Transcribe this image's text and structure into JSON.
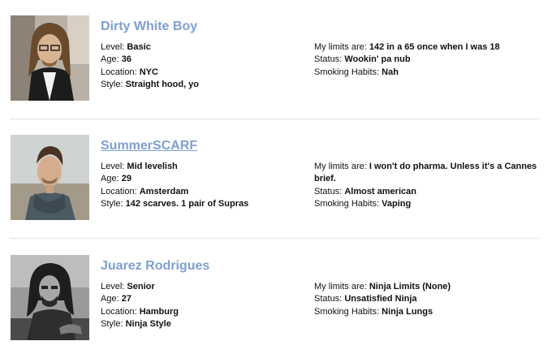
{
  "profiles": [
    {
      "name": "Dirty White Boy",
      "left": [
        {
          "label": "Level:",
          "value": "Basic"
        },
        {
          "label": "Age:",
          "value": "36"
        },
        {
          "label": "Location:",
          "value": "NYC"
        },
        {
          "label": "Style:",
          "value": "Straight hood, yo"
        }
      ],
      "right": [
        {
          "label": "My limits are:",
          "value": "142 in a 65 once when I was 18"
        },
        {
          "label": "Status:",
          "value": "Wookin' pa nub"
        },
        {
          "label": "Smoking Habits:",
          "value": "Nah"
        }
      ]
    },
    {
      "name": "SummerSCARF",
      "left": [
        {
          "label": "Level:",
          "value": "Mid levelish"
        },
        {
          "label": "Age:",
          "value": "29"
        },
        {
          "label": "Location:",
          "value": "Amsterdam"
        },
        {
          "label": "Style:",
          "value": "142 scarves. 1 pair of Supras"
        }
      ],
      "right": [
        {
          "label": "My limits are:",
          "value": "I won't do pharma. Unless it's a Cannes brief."
        },
        {
          "label": "Status:",
          "value": "Almost american"
        },
        {
          "label": "Smoking Habits:",
          "value": "Vaping"
        }
      ]
    },
    {
      "name": "Juarez Rodrigues",
      "left": [
        {
          "label": "Level:",
          "value": "Senior"
        },
        {
          "label": "Age:",
          "value": "27"
        },
        {
          "label": "Location:",
          "value": "Hamburg"
        },
        {
          "label": "Style:",
          "value": "Ninja Style"
        }
      ],
      "right": [
        {
          "label": "My limits are:",
          "value": "Ninja Limits (None)"
        },
        {
          "label": "Status:",
          "value": "Unsatisfied Ninja"
        },
        {
          "label": "Smoking Habits:",
          "value": "Ninja Lungs"
        }
      ]
    }
  ],
  "colors": {
    "name_link": "#7f9fd1",
    "divider": "#e3e3e3"
  }
}
